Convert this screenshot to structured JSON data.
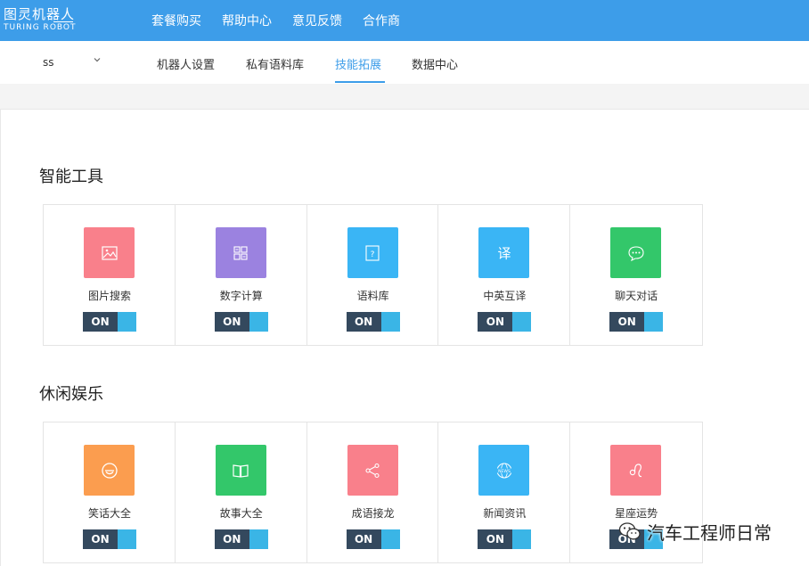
{
  "logo": {
    "cn": "图灵机器人",
    "en": "TURING ROBOT"
  },
  "topnav": [
    "套餐购买",
    "帮助中心",
    "意见反馈",
    "合作商"
  ],
  "robot_select": {
    "value": "ss"
  },
  "tabs": [
    {
      "label": "机器人设置",
      "active": false
    },
    {
      "label": "私有语料库",
      "active": false
    },
    {
      "label": "技能拓展",
      "active": true
    },
    {
      "label": "数据中心",
      "active": false
    }
  ],
  "sections": [
    {
      "title": "智能工具",
      "items": [
        {
          "label": "图片搜索",
          "icon": "image-icon",
          "color": "#f9808b",
          "toggle": "ON"
        },
        {
          "label": "数字计算",
          "icon": "calculator-icon",
          "color": "#9b82e0",
          "toggle": "ON"
        },
        {
          "label": "语料库",
          "icon": "question-book-icon",
          "color": "#3ab5f5",
          "toggle": "ON"
        },
        {
          "label": "中英互译",
          "icon": "translate-icon",
          "color": "#3ab5f5",
          "toggle": "ON"
        },
        {
          "label": "聊天对话",
          "icon": "chat-bubble-icon",
          "color": "#33c76a",
          "toggle": "ON"
        }
      ]
    },
    {
      "title": "休闲娱乐",
      "items": [
        {
          "label": "笑话大全",
          "icon": "smiley-icon",
          "color": "#fb9d4f",
          "toggle": "ON"
        },
        {
          "label": "故事大全",
          "icon": "book-icon",
          "color": "#33c76a",
          "toggle": "ON"
        },
        {
          "label": "成语接龙",
          "icon": "share-icon",
          "color": "#f9808b",
          "toggle": "ON"
        },
        {
          "label": "新闻资讯",
          "icon": "news-globe-icon",
          "color": "#3ab5f5",
          "toggle": "ON"
        },
        {
          "label": "星座运势",
          "icon": "leo-icon",
          "color": "#f9808b",
          "toggle": "ON"
        }
      ]
    }
  ],
  "watermark": {
    "text": "汽车工程师日常",
    "icon": "wechat-icon"
  },
  "colors": {
    "topbar": "#3d9de9",
    "accent": "#3d9de9",
    "toggle_on": "#34495e",
    "toggle_knob": "#3ab5e6"
  }
}
